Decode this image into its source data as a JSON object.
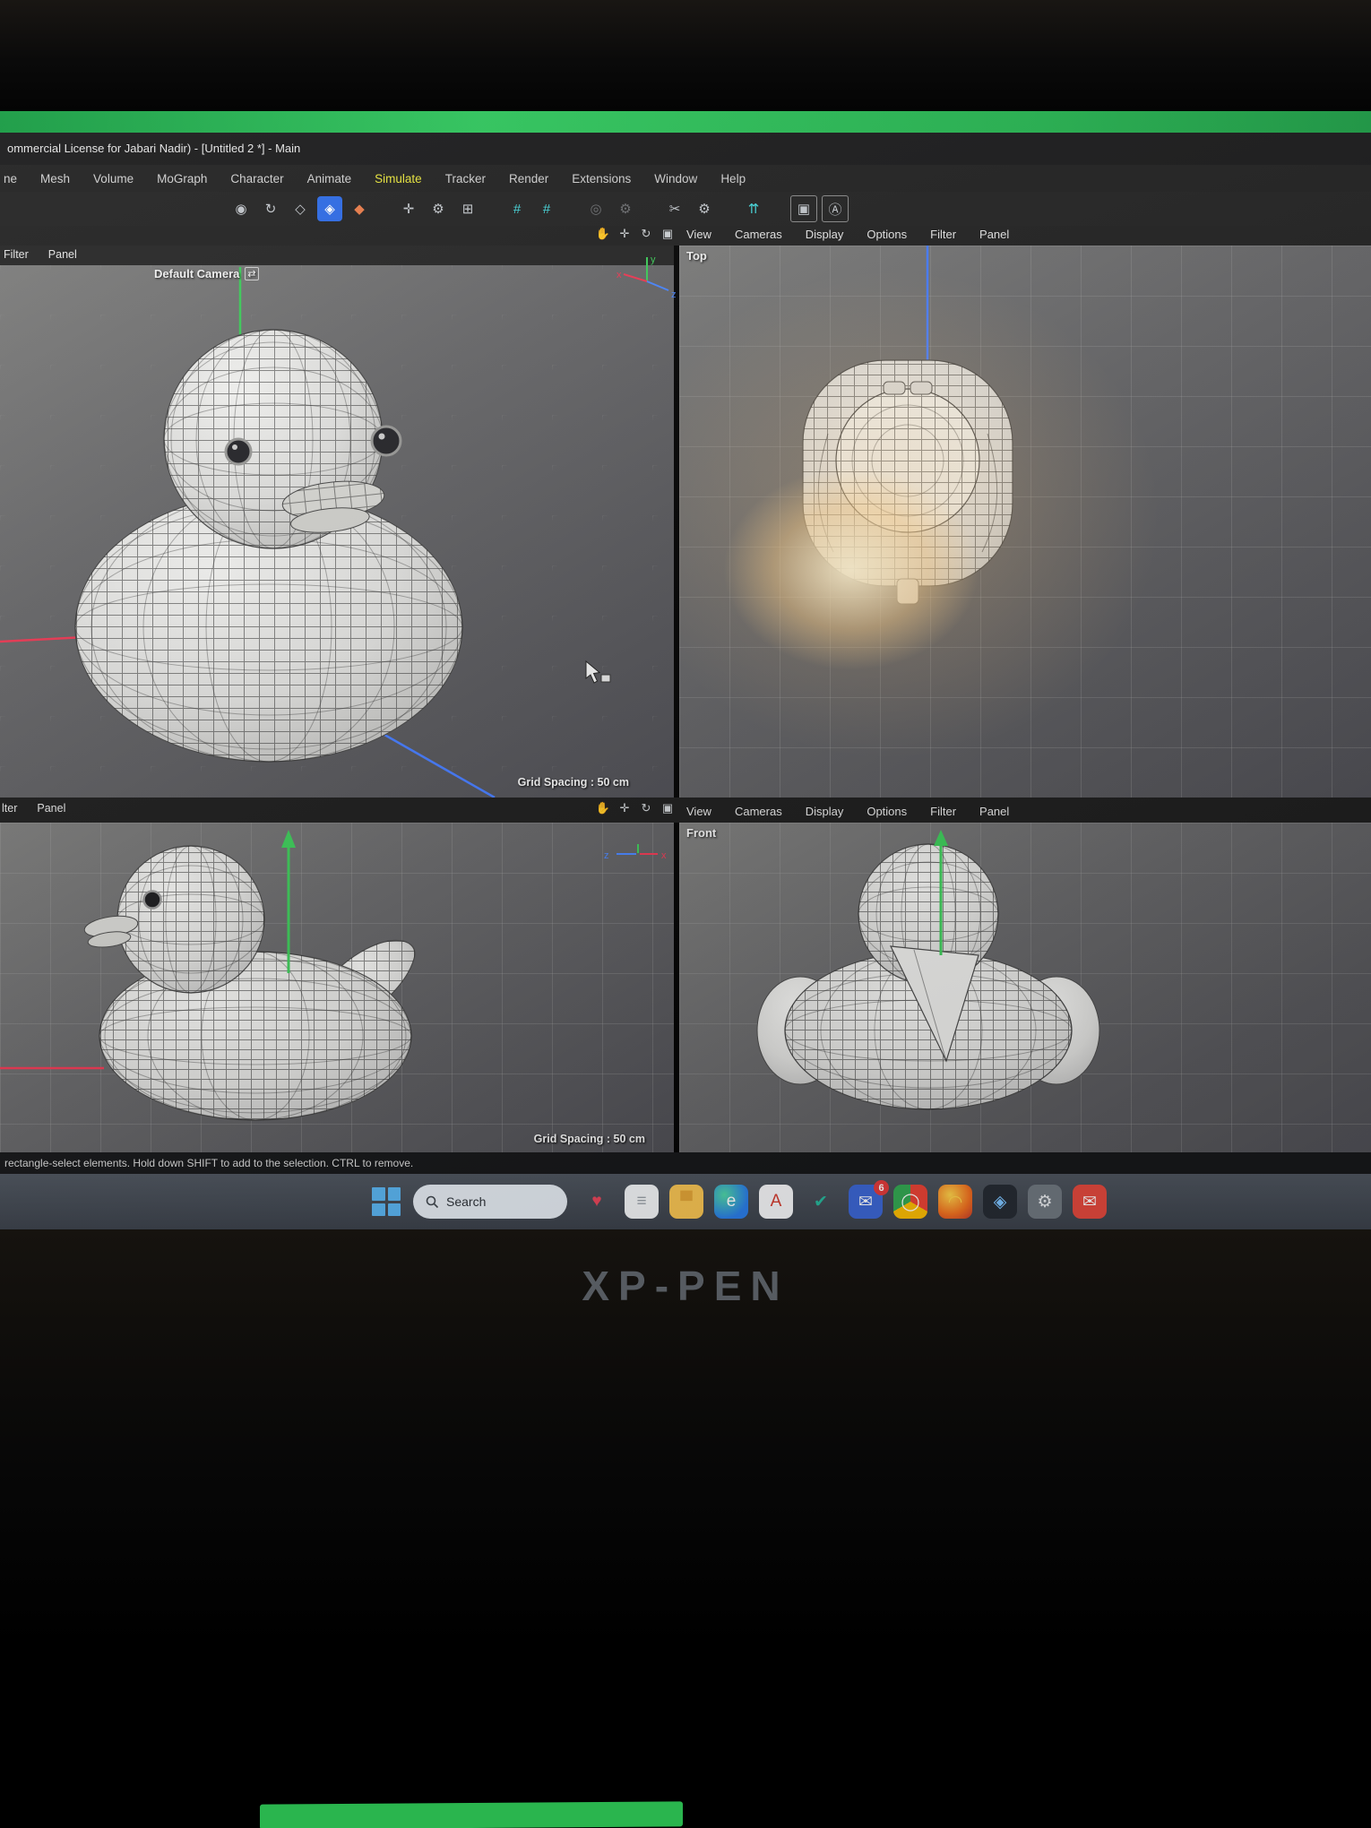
{
  "title_bar": {
    "text": "ommercial License for Jabari Nadir) - [Untitled 2 *] - Main"
  },
  "menu_bar": {
    "items": [
      "ne",
      "Mesh",
      "Volume",
      "MoGraph",
      "Character",
      "Animate",
      {
        "label": "Simulate",
        "class": "hl"
      },
      "Tracker",
      "Render",
      "Extensions",
      "Window",
      "Help"
    ]
  },
  "toolbar": {
    "icons": [
      {
        "name": "camera-nav-icon",
        "glyph": "◉"
      },
      {
        "name": "orbit-icon",
        "glyph": "↻"
      },
      {
        "name": "scale-tool-icon",
        "glyph": "◇"
      },
      {
        "name": "model-tool-icon",
        "glyph": "◈",
        "class": "active"
      },
      {
        "name": "workplane-icon",
        "glyph": "◆",
        "class": "warm"
      },
      {
        "name": "move-tool-icon",
        "glyph": "✛",
        "class": "gap"
      },
      {
        "name": "settings-gear-icon",
        "glyph": "⚙"
      },
      {
        "name": "grid-array-icon",
        "glyph": "⊞"
      },
      {
        "name": "snap-icon",
        "glyph": "#",
        "class": "teal gap"
      },
      {
        "name": "quantize-icon",
        "glyph": "#",
        "class": "teal"
      },
      {
        "name": "disabled-circle-icon",
        "glyph": "◎",
        "class": "dim gap"
      },
      {
        "name": "disabled-gear-icon",
        "glyph": "⚙",
        "class": "dim"
      },
      {
        "name": "cut-tool-icon",
        "glyph": "✂",
        "class": "gap"
      },
      {
        "name": "tool-gear-icon",
        "glyph": "⚙"
      },
      {
        "name": "up-arrows-icon",
        "glyph": "⇈",
        "class": "teal gap"
      },
      {
        "name": "render-region-icon",
        "glyph": "▣",
        "class": "boxed gap"
      },
      {
        "name": "annotation-icon",
        "glyph": "Ⓐ",
        "class": "boxed"
      }
    ]
  },
  "viewport_controls": {
    "icons": [
      {
        "name": "pan-hand-icon",
        "glyph": "✋"
      },
      {
        "name": "move-icon",
        "glyph": "✛"
      },
      {
        "name": "rotate-icon",
        "glyph": "↻"
      },
      {
        "name": "maximize-icon",
        "glyph": "▣"
      }
    ]
  },
  "viewport_menu": {
    "items": [
      "View",
      "Cameras",
      "Display",
      "Options",
      "Filter",
      "Panel"
    ]
  },
  "left_header": {
    "items": [
      "Filter",
      "Panel"
    ]
  },
  "mid_left_header": {
    "items": [
      "lter",
      "Panel"
    ]
  },
  "viewports": {
    "perspective": {
      "label": "Default Camera",
      "grid_spacing": "Grid Spacing : 50 cm"
    },
    "top": {
      "label": "Top"
    },
    "side": {
      "grid_spacing": "Grid Spacing : 50 cm"
    },
    "front": {
      "label": "Front"
    }
  },
  "axis_gizmo": {
    "x": "x",
    "y": "y",
    "z": "z"
  },
  "icons": {
    "camera_swap": "⇄"
  },
  "status_bar": {
    "text": "rectangle-select elements. Hold down SHIFT to add to the selection. CTRL to remove."
  },
  "taskbar": {
    "search_label": "Search",
    "badge_count": "6",
    "icons": [
      {
        "name": "widgets-heart-icon",
        "glyph": "♥",
        "color": "#e8465a",
        "bg": "transparent"
      },
      {
        "name": "notepad-icon",
        "glyph": "≡",
        "color": "#9aa0a8",
        "bg": "#f2f4f6"
      },
      {
        "name": "file-explorer-icon",
        "glyph": "▀",
        "color": "#e2a437",
        "bg": "#f7c453"
      },
      {
        "name": "edge-browser-icon",
        "glyph": "e",
        "color": "#ffffff",
        "bg": "radial-gradient(circle at 30% 30%, #4fd6a6, #2b7de8 70%)"
      },
      {
        "name": "document-a-icon",
        "glyph": "A",
        "color": "#d23b2f",
        "bg": "#f5f6f8"
      },
      {
        "name": "todo-check-icon",
        "glyph": "✔",
        "color": "#28b79c",
        "bg": "transparent"
      },
      {
        "name": "mail-app-icon",
        "glyph": "✉",
        "color": "#ffffff",
        "bg": "#3c66d4",
        "badge": "6"
      },
      {
        "name": "chrome-browser-icon",
        "glyph": "◯",
        "color": "#ffffff",
        "bg": "conic-gradient(#e94335 0 120deg, #fbbc05 0 240deg, #34a853 0 360deg)"
      },
      {
        "name": "firefox-browser-icon",
        "glyph": "◠",
        "color": "#ffd24a",
        "bg": "radial-gradient(circle at 35% 30%, #ffd24a, #f07020 60%, #c43b2a)"
      },
      {
        "name": "photos-icon",
        "glyph": "◈",
        "color": "#7cc3ff",
        "bg": "#262b33"
      },
      {
        "name": "settings-gear-icon",
        "glyph": "⚙",
        "color": "#e8eaed",
        "bg": "#707780"
      },
      {
        "name": "gmail-icon",
        "glyph": "✉",
        "color": "#ffffff",
        "bg": "#e2493e"
      }
    ]
  },
  "monitor": {
    "brand": "XP-PEN"
  }
}
